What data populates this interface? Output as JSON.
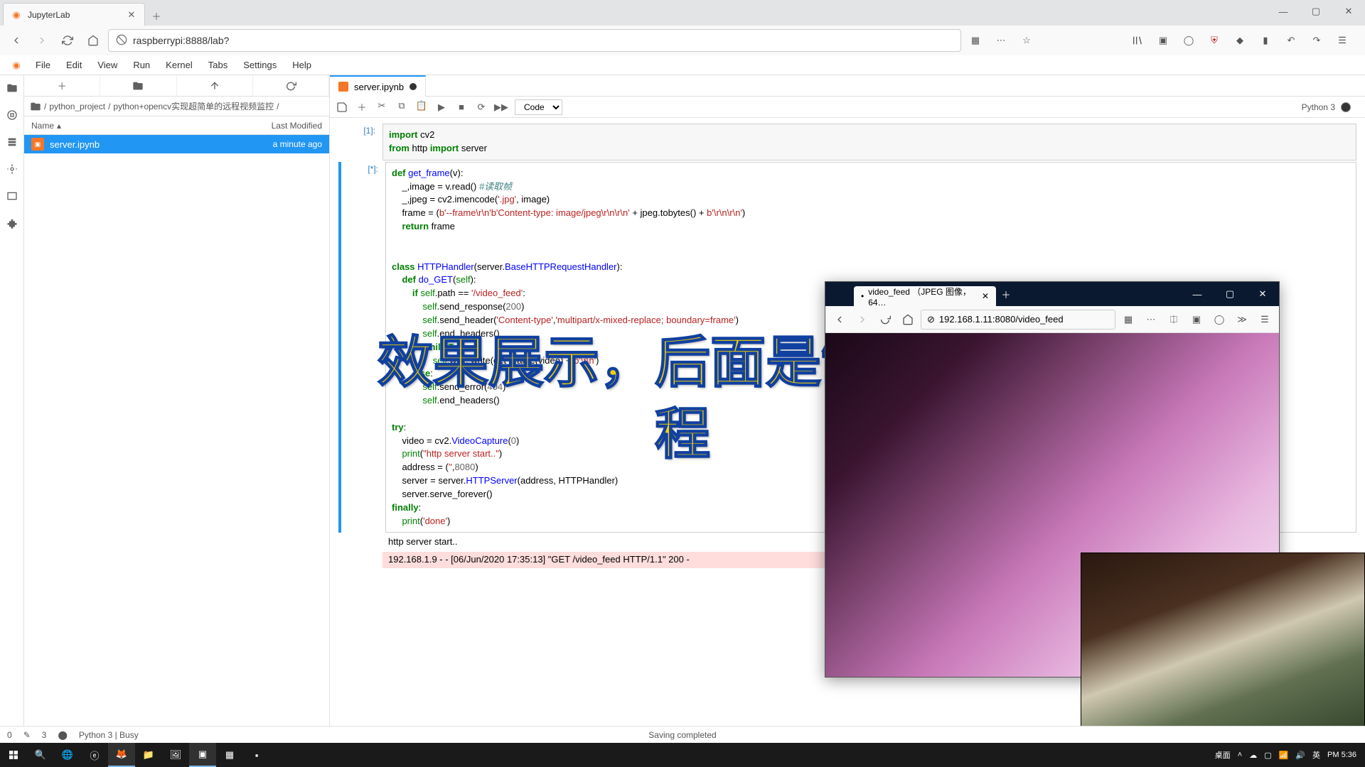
{
  "browser": {
    "tab_title": "JupyterLab",
    "url": "raspberrypi:8888/lab?"
  },
  "jlab": {
    "menu": [
      "File",
      "Edit",
      "View",
      "Run",
      "Kernel",
      "Tabs",
      "Settings",
      "Help"
    ],
    "breadcrumb": [
      "python_project",
      "python+opencv实现超简单的远程视频监控"
    ],
    "fb_header_name": "Name",
    "fb_header_mod": "Last Modified",
    "file_name": "server.ipynb",
    "file_mod": "a minute ago",
    "nb_tab": "server.ipynb",
    "cell_type": "Code",
    "kernel_name": "Python 3",
    "prompts": {
      "c1": "[1]:",
      "c2": "[*]:"
    },
    "output_ok": "http server start..",
    "output_err": "192.168.1.9 - - [06/Jun/2020 17:35:13] \"GET /video_feed HTTP/1.1\" 200 -",
    "status_left1": "0",
    "status_left2": "3",
    "status_kernel": "Python 3 | Busy",
    "status_center": "Saving completed"
  },
  "overlay": {
    "line1": "效果展示，后面是制作过",
    "line2": "程"
  },
  "win2": {
    "tab_title": "video_feed （JPEG 图像，64…",
    "url": "192.168.1.11:8080/video_feed"
  },
  "taskbar": {
    "tray_lang_label": "桌面",
    "tray_ime": "英",
    "tray_time": "PM 5:36"
  }
}
